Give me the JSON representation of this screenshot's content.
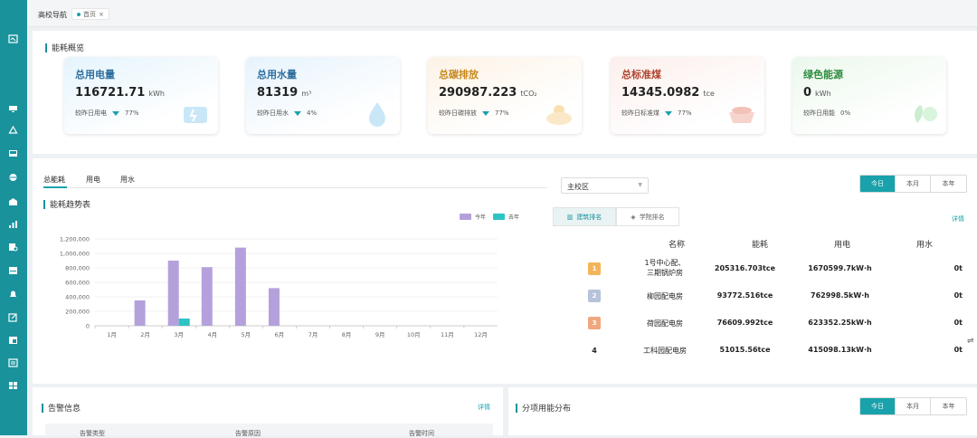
{
  "tabbar": {
    "title": "高校导航",
    "home_tab": "首页",
    "close_glyph": "×"
  },
  "overview": {
    "title": "能耗概览",
    "cards": [
      {
        "title": "总用电量",
        "value": "116721.71",
        "unit": "kWh",
        "compare_label": "较昨日用电",
        "percent": "77%",
        "color": "#2f6f9f",
        "bg": "#e5f4fd",
        "icon": "plug-icon"
      },
      {
        "title": "总用水量",
        "value": "81319",
        "unit": "m³",
        "compare_label": "较昨日用水",
        "percent": "4%",
        "color": "#2f6f9f",
        "bg": "#e6f3fc",
        "icon": "water-drop-icon"
      },
      {
        "title": "总碳排放",
        "value": "290987.223",
        "unit": "tCO₂",
        "compare_label": "较昨日碳排放",
        "percent": "77%",
        "color": "#c7891e",
        "bg": "#fdf3e6",
        "icon": "co2-cloud-icon"
      },
      {
        "title": "总标准煤",
        "value": "14345.0982",
        "unit": "tce",
        "compare_label": "较昨日标准煤",
        "percent": "77%",
        "color": "#b0452f",
        "bg": "#fcefec",
        "icon": "coal-cart-icon"
      },
      {
        "title": "绿色能源",
        "value": "0",
        "unit": "kWh",
        "compare_label": "较昨日用能",
        "percent": "0%",
        "color": "#2e8b3e",
        "bg": "#ebf8ec",
        "icon": "leaf-icon"
      }
    ]
  },
  "energy_tabs": [
    "总能耗",
    "用电",
    "用水"
  ],
  "trend": {
    "title": "能耗趋势表",
    "legend_this_year": "今年",
    "legend_last_year": "去年"
  },
  "chart_data": {
    "type": "bar",
    "categories": [
      "1月",
      "2月",
      "3月",
      "4月",
      "5月",
      "6月",
      "7月",
      "8月",
      "9月",
      "10月",
      "11月",
      "12月"
    ],
    "series": [
      {
        "name": "今年",
        "color": "#b4a1dc",
        "values": [
          0,
          350000,
          900000,
          810000,
          1080000,
          520000,
          0,
          0,
          0,
          0,
          0,
          0
        ]
      },
      {
        "name": "去年",
        "color": "#2ec3c4",
        "values": [
          0,
          0,
          100000,
          0,
          0,
          0,
          0,
          0,
          0,
          0,
          0,
          0
        ]
      }
    ],
    "yticks": [
      "0",
      "200,000",
      "400,000",
      "600,000",
      "800,000",
      "1,000,000",
      "1,200,000"
    ],
    "ylim": [
      0,
      1200000
    ],
    "grid": true,
    "legend_position": "top-right"
  },
  "campus_select": {
    "value": "主校区"
  },
  "period_seg": [
    "今日",
    "本月",
    "本年"
  ],
  "ranking": {
    "tabs": [
      "建筑排名",
      "学院排名"
    ],
    "detail": "详情",
    "headers": [
      "名称",
      "能耗",
      "用电",
      "用水"
    ],
    "rows": [
      {
        "rank": "1",
        "name_line1": "1号中心配、",
        "name_line2": "三期锅炉房",
        "energy": "205316.703tce",
        "power": "1670599.7kW·h",
        "water": "0t",
        "medal_color": "#f2b55b"
      },
      {
        "rank": "2",
        "name_line1": "柳园配电房",
        "name_line2": "",
        "energy": "93772.516tce",
        "power": "762998.5kW·h",
        "water": "0t",
        "medal_color": "#b7c3d9"
      },
      {
        "rank": "3",
        "name_line1": "荷园配电房",
        "name_line2": "",
        "energy": "76609.992tce",
        "power": "623352.25kW·h",
        "water": "0t",
        "medal_color": "#f0a77f"
      },
      {
        "rank": "4",
        "name_line1": "工科园配电房",
        "name_line2": "",
        "energy": "51015.56tce",
        "power": "415098.13kW·h",
        "water": "0t",
        "medal_color": ""
      }
    ]
  },
  "alarm": {
    "title": "告警信息",
    "detail": "详情",
    "columns": [
      "告警类型",
      "告警原因",
      "告警时间"
    ]
  },
  "distribution": {
    "title": "分项用能分布"
  }
}
